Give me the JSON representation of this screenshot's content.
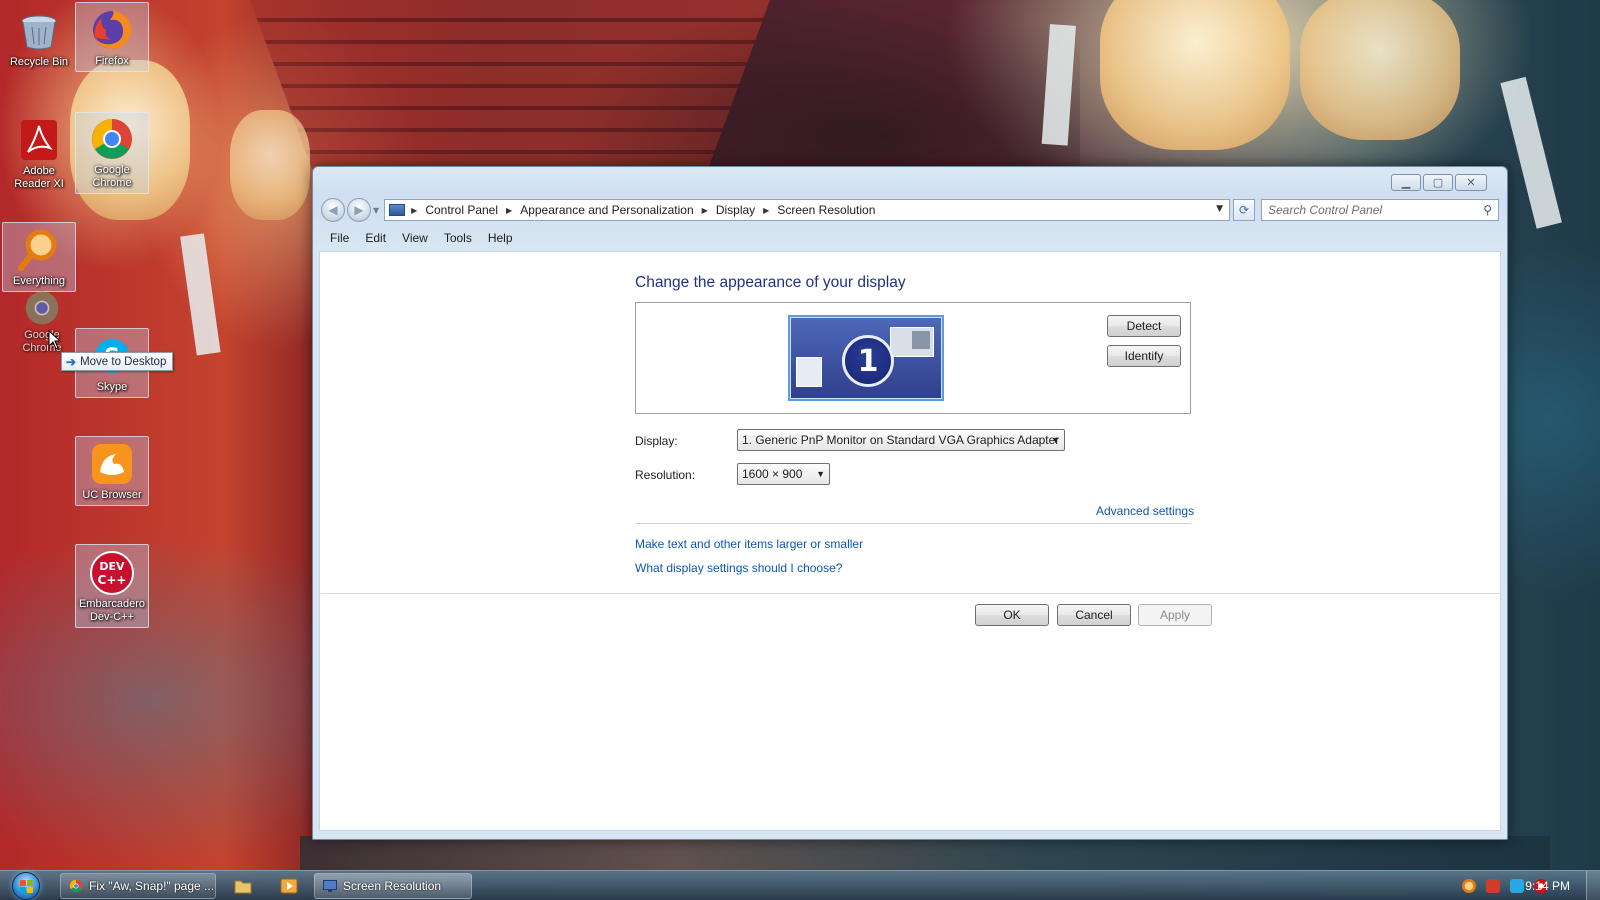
{
  "desktop": {
    "icons": [
      {
        "label": "Recycle Bin"
      },
      {
        "label": "Firefox"
      },
      {
        "label": "Adobe Reader XI"
      },
      {
        "label": "Google Chrome"
      },
      {
        "label": "Everything"
      },
      {
        "label": "Google Chrome"
      },
      {
        "label": "Skype"
      },
      {
        "label": "UC Browser"
      },
      {
        "label": "Embarcadero Dev-C++"
      }
    ],
    "drag_tooltip": "Move to Desktop"
  },
  "window": {
    "breadcrumbs": [
      "Control Panel",
      "Appearance and Personalization",
      "Display",
      "Screen Resolution"
    ],
    "search_placeholder": "Search Control Panel",
    "menu": [
      "File",
      "Edit",
      "View",
      "Tools",
      "Help"
    ],
    "page_title": "Change the appearance of your display",
    "monitor_number": "1",
    "detect_label": "Detect",
    "identify_label": "Identify",
    "display_label": "Display:",
    "display_value": "1. Generic PnP Monitor on Standard VGA Graphics Adapter",
    "resolution_label": "Resolution:",
    "resolution_value": "1600 × 900",
    "advanced_link": "Advanced settings",
    "link_text_size": "Make text and other items larger or smaller",
    "link_help": "What display settings should I choose?",
    "ok_label": "OK",
    "cancel_label": "Cancel",
    "apply_label": "Apply"
  },
  "taskbar": {
    "items": [
      {
        "label": "Fix \"Aw, Snap!\" page ..."
      },
      {
        "label": "Screen Resolution"
      }
    ],
    "clock": "9:14 PM"
  },
  "colors": {
    "title_blue": "#1e3287",
    "link_blue": "#0b57b3"
  }
}
